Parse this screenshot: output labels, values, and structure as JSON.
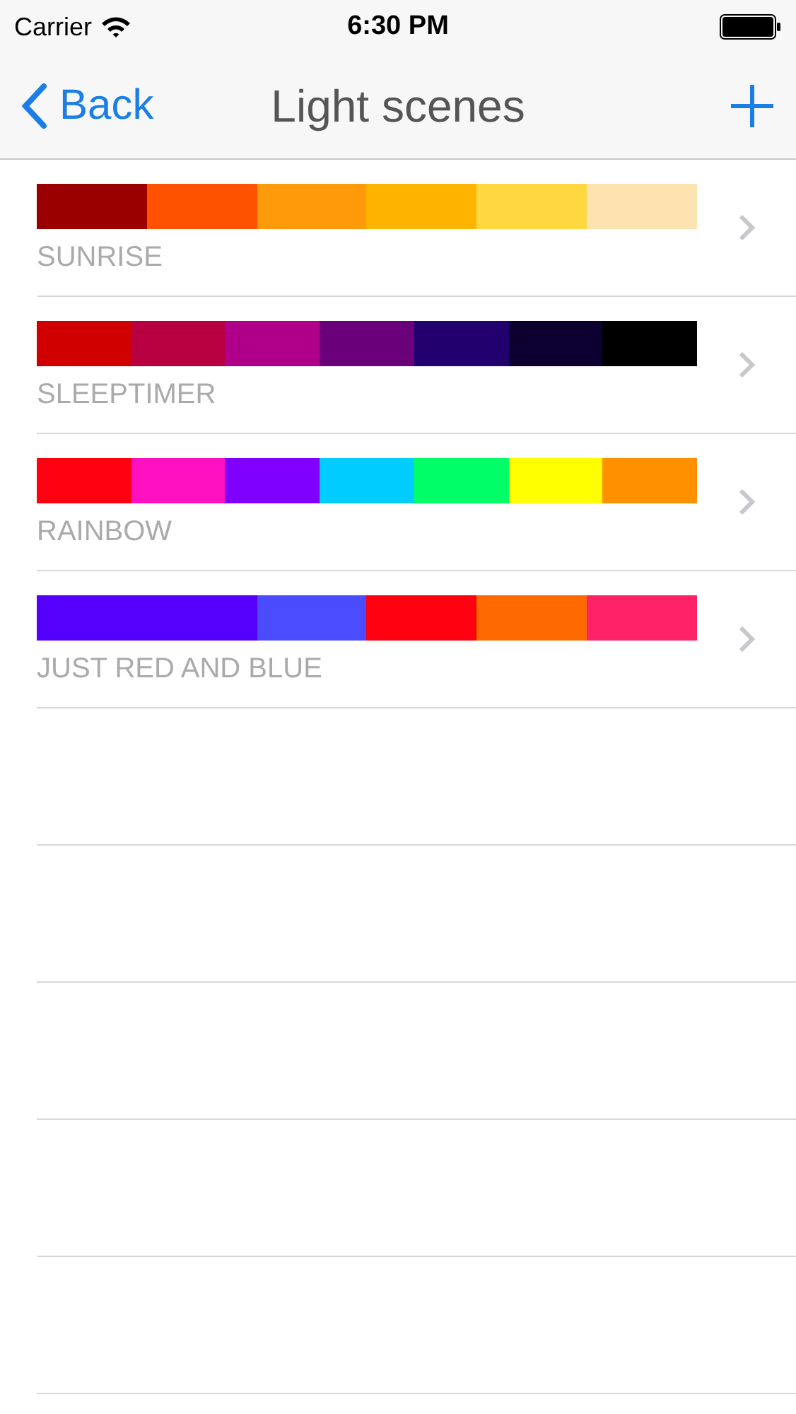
{
  "status_bar": {
    "carrier": "Carrier",
    "time": "6:30 PM"
  },
  "nav": {
    "back": "Back",
    "title": "Light scenes"
  },
  "scenes": [
    {
      "name": "SUNRISE",
      "swatches": [
        {
          "color": "#9a0000"
        },
        {
          "color": "#ff5200"
        },
        {
          "color": "#ff9a0a"
        },
        {
          "color": "#ffb400"
        },
        {
          "color": "#ffd840"
        },
        {
          "color": "#fce3b0"
        }
      ]
    },
    {
      "name": "SLEEPTIMER",
      "swatches": [
        {
          "color": "#d00000"
        },
        {
          "color": "#b80040"
        },
        {
          "color": "#b0008a"
        },
        {
          "color": "#6a007a"
        },
        {
          "color": "#22006e"
        },
        {
          "color": "#0c0030"
        },
        {
          "color": "#000000"
        }
      ]
    },
    {
      "name": "RAINBOW",
      "swatches": [
        {
          "color": "#ff0010"
        },
        {
          "color": "#ff10c0"
        },
        {
          "color": "#8000ff"
        },
        {
          "color": "#00ccff"
        },
        {
          "color": "#00ff66"
        },
        {
          "color": "#ffff00"
        },
        {
          "color": "#ff9000"
        }
      ]
    },
    {
      "name": "JUST RED AND BLUE",
      "swatches": [
        {
          "color": "#5500ff"
        },
        {
          "color": "#5500ff"
        },
        {
          "color": "#4b4bff"
        },
        {
          "color": "#ff0010"
        },
        {
          "color": "#ff6a00"
        },
        {
          "color": "#ff2266"
        }
      ]
    }
  ]
}
